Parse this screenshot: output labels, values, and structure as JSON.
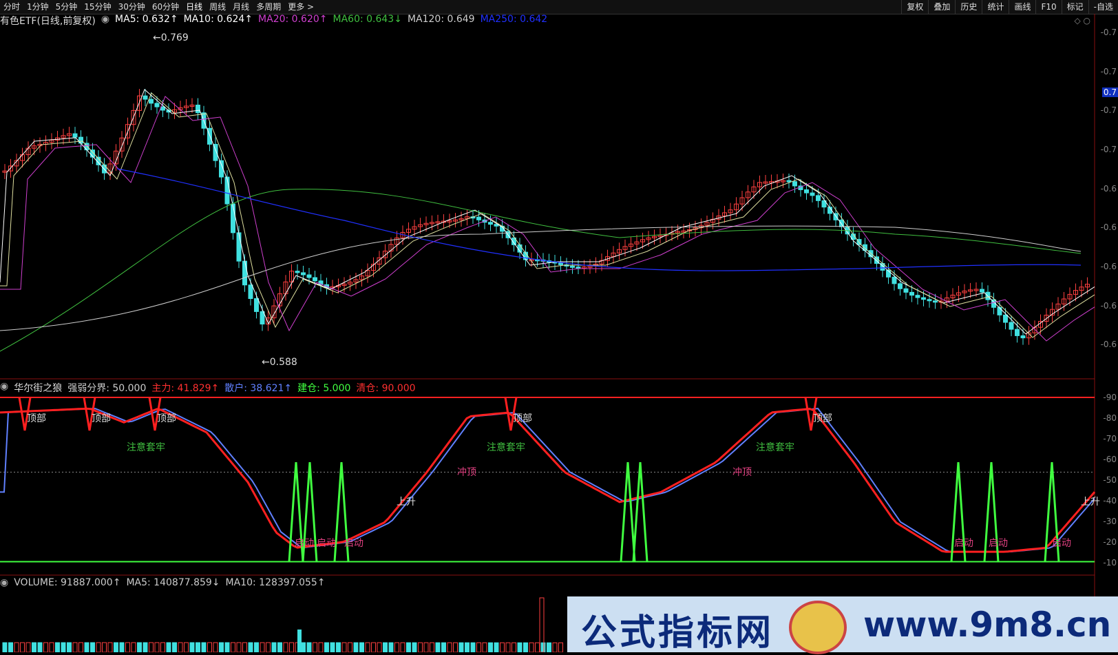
{
  "toolbar": {
    "periods": [
      "分时",
      "1分钟",
      "5分钟",
      "15分钟",
      "30分钟",
      "60分钟",
      "日线",
      "周线",
      "月线",
      "多周期",
      "更多 >"
    ],
    "tools": [
      "复权",
      "叠加",
      "历史",
      "统计",
      "画线",
      "F10",
      "标记",
      "-自选"
    ]
  },
  "main": {
    "title": "有色ETF(日线,前复权)",
    "ma": [
      {
        "label": "MA5: 0.632↑",
        "color": "#ffffff"
      },
      {
        "label": "MA10: 0.624↑",
        "color": "#ffffff"
      },
      {
        "label": "MA20: 0.620↑",
        "color": "#d040d0"
      },
      {
        "label": "MA60: 0.643↓",
        "color": "#40c040"
      },
      {
        "label": "MA120: 0.649",
        "color": "#d0d0d0"
      },
      {
        "label": "MA250: 0.642",
        "color": "#2030ff"
      }
    ],
    "high_label": "0.769",
    "low_label": "0.588",
    "right_tag": "0.7",
    "scale_labels": [
      "0.7",
      "0.7",
      "0.7",
      "0.7",
      "0.6",
      "0.6",
      "0.6",
      "0.6",
      "0.6"
    ],
    "colors": {
      "up": "#ff4040",
      "down": "#40e0e0",
      "ma5": "#ffffff",
      "ma20": "#d040d0",
      "ma60": "#40c040",
      "ma120": "#d0d0d0",
      "ma250": "#2030ff"
    }
  },
  "indicator": {
    "name": "华尔街之狼",
    "items": [
      {
        "label": "强弱分界: 50.000",
        "color": "#cccccc"
      },
      {
        "label": "主力: 41.829↑",
        "color": "#ff3030"
      },
      {
        "label": "散户: 38.621↑",
        "color": "#6080ff"
      },
      {
        "label": "建仓: 5.000",
        "color": "#40ff40"
      },
      {
        "label": "清仓: 90.000",
        "color": "#ff3030"
      }
    ],
    "annotations": {
      "top": "顶部",
      "caution": "注意套牢",
      "rush": "冲顶",
      "rise": "上升",
      "start": "启动"
    },
    "scale_labels": [
      "90",
      "80",
      "70",
      "60",
      "50",
      "40",
      "30",
      "20",
      "10"
    ]
  },
  "volume": {
    "items": [
      {
        "label": "VOLUME: 91887.000↑",
        "color": "#cccccc"
      },
      {
        "label": "MA5: 140877.859↓",
        "color": "#cccccc"
      },
      {
        "label": "MA10: 128397.055↑",
        "color": "#cccccc"
      }
    ]
  },
  "watermark": {
    "cn": "公式指标网",
    "url": "www.9m8.cn"
  }
}
